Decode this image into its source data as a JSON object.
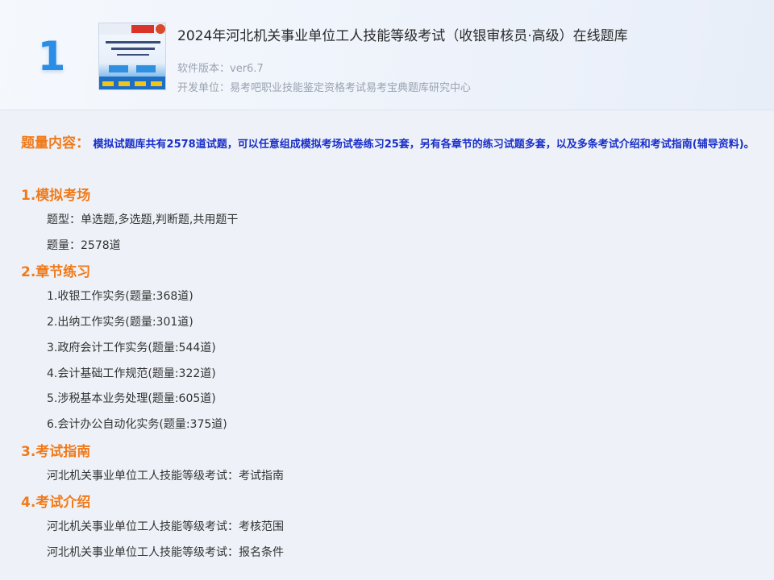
{
  "header": {
    "rank": "1",
    "title": "2024年河北机关事业单位工人技能等级考试（收银审核员·高级）在线题库",
    "version": "软件版本：ver6.7",
    "developer": "开发单位：易考吧职业技能鉴定资格考试易考宝典题库研究中心"
  },
  "intro": {
    "label": "题量内容：",
    "text": "模拟试题库共有2578道试题，可以任意组成模拟考场试卷练习25套，另有各章节的练习试题多套，以及多条考试介绍和考试指南(辅导资料)。"
  },
  "sections": [
    {
      "title": "1.模拟考场",
      "items": [
        "题型：单选题,多选题,判断题,共用题干",
        "题量：2578道"
      ]
    },
    {
      "title": "2.章节练习",
      "items": [
        "1.收银工作实务(题量:368道)",
        "2.出纳工作实务(题量:301道)",
        "3.政府会计工作实务(题量:544道)",
        "4.会计基础工作规范(题量:322道)",
        "5.涉税基本业务处理(题量:605道)",
        "6.会计办公自动化实务(题量:375道)"
      ]
    },
    {
      "title": "3.考试指南",
      "items": [
        "河北机关事业单位工人技能等级考试：考试指南"
      ]
    },
    {
      "title": "4.考试介绍",
      "items": [
        "河北机关事业单位工人技能等级考试：考核范围",
        "河北机关事业单位工人技能等级考试：报名条件"
      ]
    }
  ]
}
